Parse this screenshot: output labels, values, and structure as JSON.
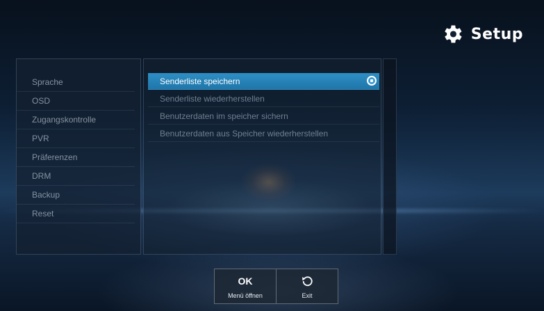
{
  "header": {
    "title": "Setup",
    "icon": "gear-icon"
  },
  "sidebar": {
    "items": [
      {
        "label": "Sprache"
      },
      {
        "label": "OSD"
      },
      {
        "label": "Zugangskontrolle"
      },
      {
        "label": "PVR"
      },
      {
        "label": "Präferenzen"
      },
      {
        "label": "DRM"
      },
      {
        "label": "Backup"
      },
      {
        "label": "Reset"
      }
    ]
  },
  "main": {
    "items": [
      {
        "label": "Senderliste speichern",
        "selected": true
      },
      {
        "label": "Senderliste wiederherstellen"
      },
      {
        "label": "Benutzerdaten im speicher sichern"
      },
      {
        "label": "Benutzerdaten aus Speicher wiederherstellen"
      }
    ]
  },
  "footer": {
    "ok": {
      "key": "OK",
      "label": "Menü öffnen"
    },
    "exit": {
      "icon": "back-arrow-icon",
      "label": "Exit"
    }
  },
  "colors": {
    "accent": "#2a88bf",
    "text_dim": "#8594a3",
    "text_bright": "#ffffff"
  }
}
